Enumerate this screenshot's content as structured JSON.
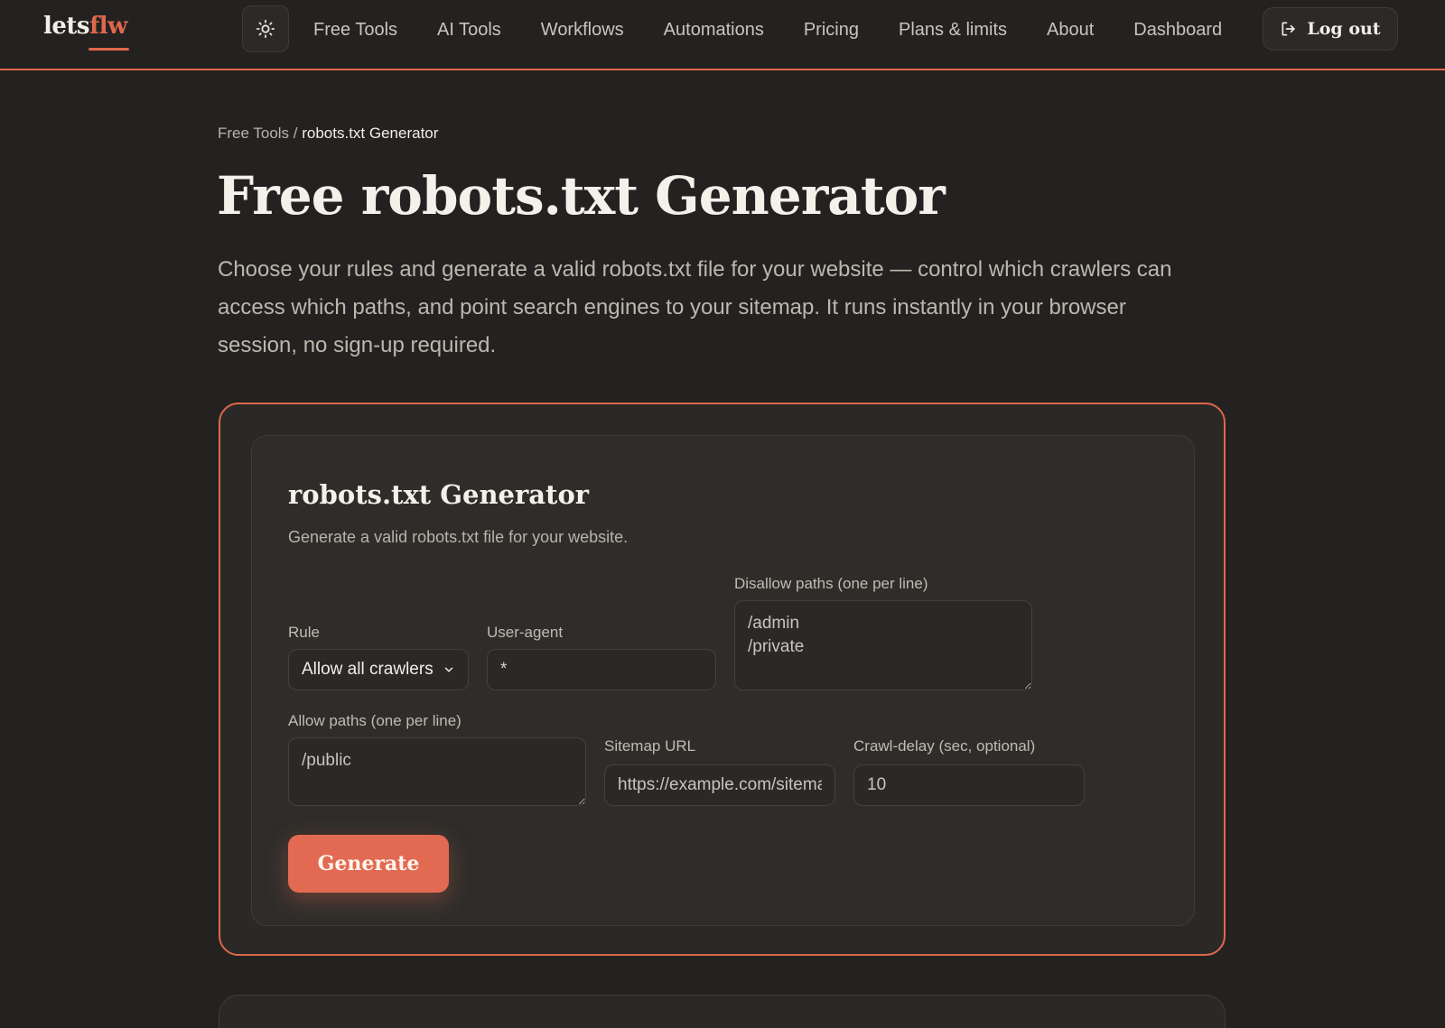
{
  "brand": {
    "part1": "lets",
    "part2": "flw"
  },
  "nav": {
    "items": [
      "Free Tools",
      "AI Tools",
      "Workflows",
      "Automations",
      "Pricing",
      "Plans & limits",
      "About",
      "Dashboard"
    ],
    "logout_label": "Log out",
    "theme_icon": "sun-icon"
  },
  "breadcrumb": {
    "parent": "Free Tools",
    "separator": " / ",
    "current": "robots.txt Generator"
  },
  "page": {
    "title": "Free robots.txt Generator",
    "description": "Choose your rules and generate a valid robots.txt file for your website — control which crawlers can access which paths, and point search engines to your sitemap. It runs instantly in your browser session, no sign-up required."
  },
  "tool": {
    "title": "robots.txt Generator",
    "subtitle": "Generate a valid robots.txt file for your website.",
    "rule": {
      "label": "Rule",
      "value": "Allow all crawlers"
    },
    "user_agent": {
      "label": "User-agent",
      "value": "*"
    },
    "disallow": {
      "label": "Disallow paths (one per line)",
      "value": "/admin\n/private"
    },
    "allow": {
      "label": "Allow paths (one per line)",
      "value": "/public"
    },
    "sitemap": {
      "label": "Sitemap URL",
      "placeholder": "https://example.com/sitemap.xml"
    },
    "crawl_delay": {
      "label": "Crawl-delay (sec, optional)",
      "placeholder": "10"
    },
    "generate_label": "Generate"
  },
  "colors": {
    "accent": "#e0674c",
    "background": "#232221",
    "card": "#2e2d2a"
  }
}
